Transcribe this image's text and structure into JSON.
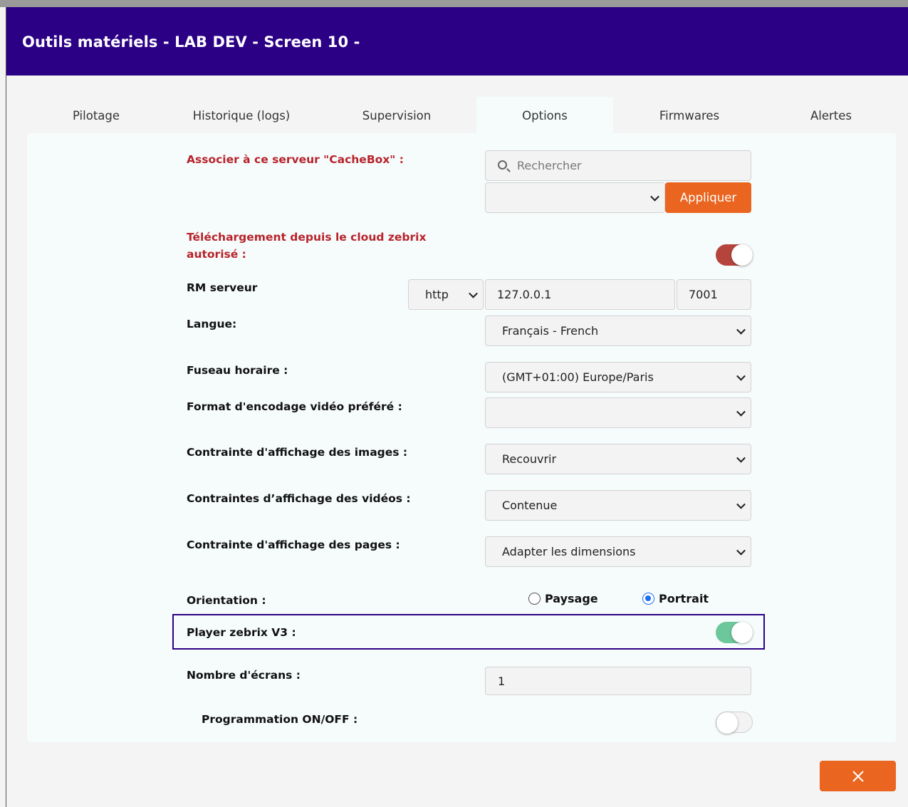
{
  "header": {
    "title": "Outils matériels - LAB DEV - Screen 10 -"
  },
  "tabs": [
    {
      "label": "Pilotage"
    },
    {
      "label": "Historique (logs)"
    },
    {
      "label": "Supervision"
    },
    {
      "label": "Options"
    },
    {
      "label": "Firmwares"
    },
    {
      "label": "Alertes"
    }
  ],
  "active_tab": "Options",
  "form": {
    "cachebox": {
      "label": "Associer à ce serveur \"CacheBox\" :",
      "search_placeholder": "Rechercher",
      "select_value": "",
      "apply_label": "Appliquer"
    },
    "cloud_download": {
      "label_line1": "Téléchargement depuis le cloud zebrix",
      "label_line2": "autorisé :",
      "enabled": true,
      "toggle_color": "#b5443c"
    },
    "rm_server": {
      "label": "RM serveur",
      "protocol": "http",
      "host": "127.0.0.1",
      "port": "7001"
    },
    "language": {
      "label": "Langue:",
      "value": "Français - French"
    },
    "timezone": {
      "label": "Fuseau horaire :",
      "value": "(GMT+01:00) Europe/Paris"
    },
    "video_encoding": {
      "label": "Format d'encodage vidéo préféré :",
      "value": ""
    },
    "image_constraint": {
      "label": "Contrainte d'affichage des images :",
      "value": "Recouvrir"
    },
    "video_constraint": {
      "label": "Contraintes d’affichage des vidéos :",
      "value": "Contenue"
    },
    "page_constraint": {
      "label": "Contrainte d'affichage des pages :",
      "value": "Adapter les dimensions"
    },
    "orientation": {
      "label": "Orientation :",
      "options": [
        "Paysage",
        "Portrait"
      ],
      "selected": "Portrait"
    },
    "player_v3": {
      "label": "Player zebrix V3 :",
      "enabled": true,
      "toggle_color": "#6cc79a"
    },
    "screen_count": {
      "label": "Nombre d'écrans :",
      "value": "1"
    },
    "schedule": {
      "label": "Programmation ON/OFF :",
      "enabled": false
    }
  },
  "close_icon": "close-icon",
  "colors": {
    "header_bg": "#2b0085",
    "accent_orange": "#ea6520",
    "label_red": "#b8232b",
    "highlight_border": "#2b0085"
  }
}
